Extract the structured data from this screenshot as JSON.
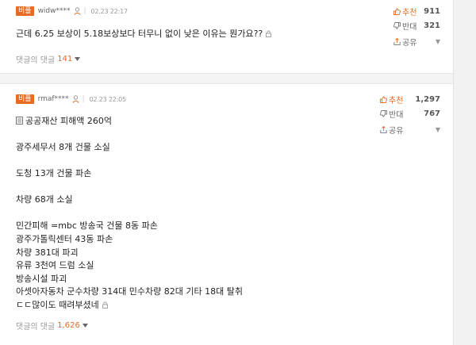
{
  "comments": [
    {
      "badge": "비플",
      "author": "widw****",
      "divider": "|",
      "date": "02.23 22:17",
      "lines": [
        "근데 6.25 보상이 5.18보상보다 터무니 없이 낮은 이유는 뭔가요??"
      ],
      "replies_label": "댓글의 댓글",
      "replies_count": "141",
      "up_label": "추천",
      "up_count": "911",
      "down_label": "반대",
      "down_count": "321",
      "share_label": "공유"
    },
    {
      "badge": "비플",
      "author": "rmaf****",
      "divider": "|",
      "date": "02.23 22:05",
      "lines": [
        "공공재산 피해액 260억",
        "광주세무서 8개 건물 소실",
        "도청 13개 건물 파손",
        "차량 68개 소실",
        "민간피해 =mbc 방송국 건물 8동 파손",
        "광주가톨릭센터 43동 파손",
        "차량 381대 파괴",
        "유류 3천여 드럼 소실",
        "방송시설 파괴",
        "아셋아자동차 군수차량 314대 민수차량 82대 기타 18대 탈취",
        "ㄷㄷ많이도 때려부셨네"
      ],
      "replies_label": "댓글의 댓글",
      "replies_count": "1,626",
      "up_label": "추천",
      "up_count": "1,297",
      "down_label": "반대",
      "down_count": "767",
      "share_label": "공유"
    }
  ],
  "icons": {
    "user": "user-icon",
    "lock": "lock-icon",
    "thumb_up": "thumb-up-icon",
    "thumb_down": "thumb-down-icon",
    "share": "share-icon",
    "doc": "document-icon",
    "caret": "caret-down-icon"
  },
  "colors": {
    "accent": "#e86b24",
    "text": "#222222",
    "muted": "#999999"
  }
}
